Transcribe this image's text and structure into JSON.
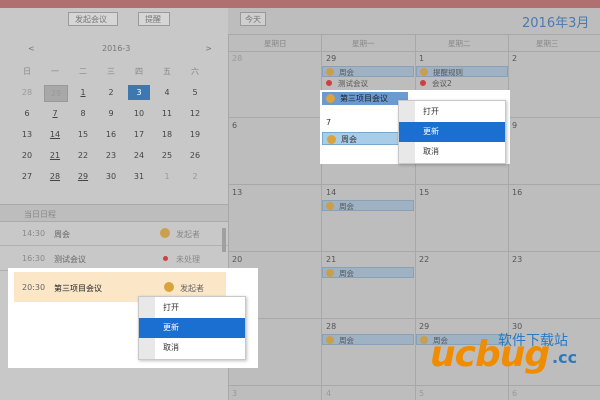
{
  "left": {
    "new_meeting": "发起会议",
    "remind": "提醒",
    "prev": "<",
    "next": ">",
    "month_label": "2016-3",
    "weekdays": [
      "日",
      "一",
      "二",
      "三",
      "四",
      "五",
      "六"
    ],
    "weeks": [
      [
        "28",
        "29",
        "1",
        "2",
        "3",
        "4",
        "5"
      ],
      [
        "6",
        "7",
        "8",
        "9",
        "10",
        "11",
        "12"
      ],
      [
        "13",
        "14",
        "15",
        "16",
        "17",
        "18",
        "19"
      ],
      [
        "20",
        "21",
        "22",
        "23",
        "24",
        "25",
        "26"
      ],
      [
        "27",
        "28",
        "29",
        "30",
        "31",
        "1",
        "2"
      ]
    ],
    "agenda_title": "当日日程",
    "agenda": [
      {
        "time": "14:30",
        "title": "周会",
        "status": "发起者"
      },
      {
        "time": "16:30",
        "title": "测试会议",
        "status": "未处理"
      },
      {
        "time": "20:30",
        "title": "第三项目会议",
        "status": "发起者"
      }
    ]
  },
  "calendar": {
    "today": "今天",
    "month_title": "2016年3月",
    "weekdays": [
      "星期日",
      "星期一",
      "星期二",
      "星期三"
    ],
    "row1": {
      "d28": "28",
      "d29": "29",
      "d1": "1",
      "d2": "2"
    },
    "row2": {
      "d6": "6",
      "d7": "7",
      "d9": "9"
    },
    "row3": {
      "d13": "13",
      "d14": "14",
      "d15": "15",
      "d16": "16"
    },
    "row4": {
      "d20": "20",
      "d21": "21",
      "d22": "22",
      "d23": "23"
    },
    "row5": {
      "d27": "27",
      "d28": "28",
      "d29": "29",
      "d30": "30"
    },
    "row6": {
      "d3": "3",
      "d4": "4",
      "d5": "5",
      "d6": "6"
    },
    "events": {
      "weekly": "周会",
      "test": "测试会议",
      "project3": "第三项目会议",
      "reminder": "提醒规则",
      "meeting2": "会议2"
    }
  },
  "context_menu": {
    "open": "打开",
    "update": "更新",
    "cancel": "取消"
  },
  "watermark": {
    "brand": "ucbug",
    "sub": "软件下载站",
    "cc": ".cc"
  },
  "colors": {
    "accent": "#1a6fd0",
    "month_title": "#4a7bb0",
    "today_cell": "#3d78b0",
    "brand_orange": "#f08c00"
  }
}
